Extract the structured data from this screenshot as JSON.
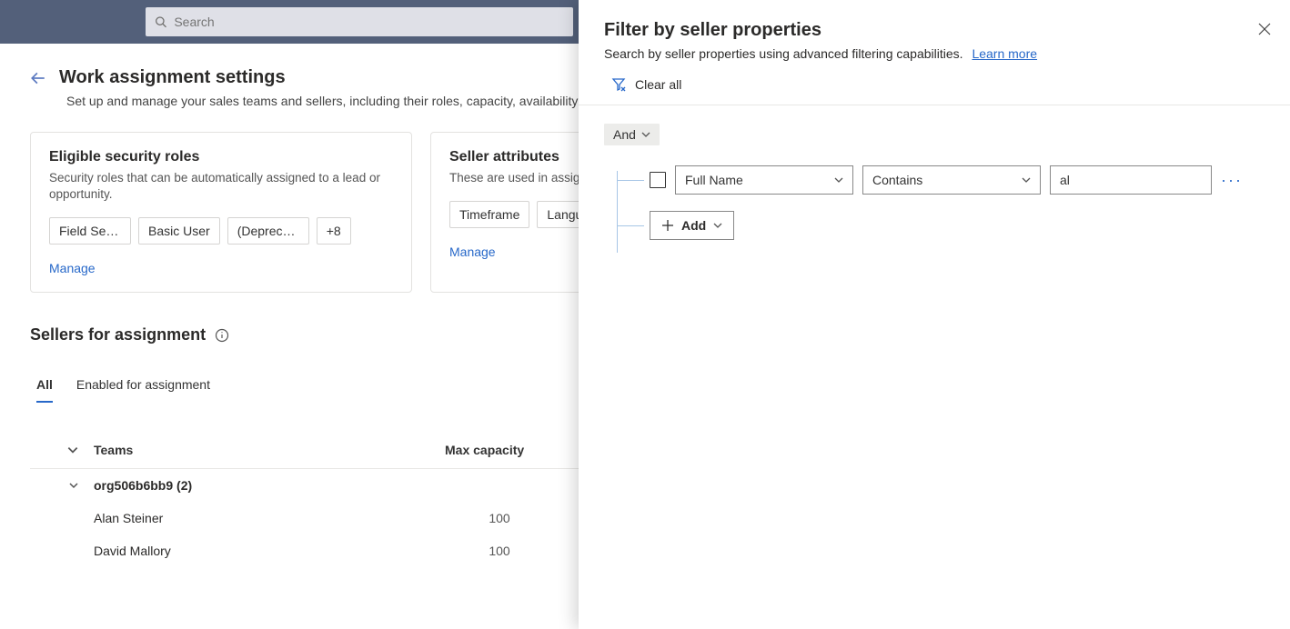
{
  "header": {
    "search_placeholder": "Search"
  },
  "page": {
    "title": "Work assignment settings",
    "description": "Set up and manage your sales teams and sellers, including their roles, capacity, availability a"
  },
  "cards": {
    "roles": {
      "title": "Eligible security roles",
      "desc": "Security roles that can be automatically assigned to a lead or opportunity.",
      "chips": [
        "Field Servic...",
        "Basic User",
        "(Deprecate...",
        "+8"
      ],
      "manage": "Manage"
    },
    "attrs": {
      "title": "Seller attributes",
      "desc": "These are used in assign",
      "chips": [
        "Timeframe",
        "Langua"
      ],
      "manage": "Manage"
    }
  },
  "sellers": {
    "title": "Sellers for assignment",
    "tabs": {
      "all": "All",
      "enabled": "Enabled for assignment"
    },
    "columns": {
      "teams": "Teams",
      "capacity": "Max capacity"
    },
    "group_label": "org506b6bb9 (2)",
    "rows": [
      {
        "name": "Alan Steiner",
        "capacity": "100"
      },
      {
        "name": "David Mallory",
        "capacity": "100"
      }
    ]
  },
  "panel": {
    "title": "Filter by seller properties",
    "desc": "Search by seller properties using advanced filtering capabilities.",
    "learn_more": "Learn more",
    "clear_all": "Clear all",
    "group_op": "And",
    "field_label": "Full Name",
    "operator_label": "Contains",
    "value": "al",
    "add_label": "Add"
  }
}
